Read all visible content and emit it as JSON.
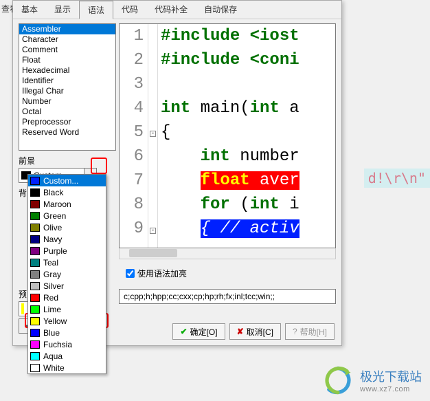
{
  "sidebar_lbl": "查看",
  "bg_snippet": "d!\\r\\n\"",
  "tabs": [
    "基本",
    "显示",
    "语法",
    "代码",
    "代码补全",
    "自动保存"
  ],
  "active_tab": 2,
  "token_list": [
    "Assembler",
    "Character",
    "Comment",
    "Float",
    "Hexadecimal",
    "Identifier",
    "Illegal Char",
    "Number",
    "Octal",
    "Preprocessor",
    "Reserved Word"
  ],
  "token_selected": 0,
  "labels": {
    "fg": "前景",
    "bg": "背",
    "preview": "预"
  },
  "fg_sel": "Custom...",
  "colors": [
    {
      "name": "Custom...",
      "hex": "#0020ff",
      "sel": true
    },
    {
      "name": "Black",
      "hex": "#000000"
    },
    {
      "name": "Maroon",
      "hex": "#800000"
    },
    {
      "name": "Green",
      "hex": "#008000"
    },
    {
      "name": "Olive",
      "hex": "#808000"
    },
    {
      "name": "Navy",
      "hex": "#000080"
    },
    {
      "name": "Purple",
      "hex": "#800080"
    },
    {
      "name": "Teal",
      "hex": "#008080"
    },
    {
      "name": "Gray",
      "hex": "#808080"
    },
    {
      "name": "Silver",
      "hex": "#c0c0c0"
    },
    {
      "name": "Red",
      "hex": "#ff0000"
    },
    {
      "name": "Lime",
      "hex": "#00ff00"
    },
    {
      "name": "Yellow",
      "hex": "#ffff00"
    },
    {
      "name": "Blue",
      "hex": "#0000ff"
    },
    {
      "name": "Fuchsia",
      "hex": "#ff00ff"
    },
    {
      "name": "Aqua",
      "hex": "#00ffff"
    },
    {
      "name": "White",
      "hex": "#ffffff"
    }
  ],
  "checkbox": {
    "label": "使用语法加亮",
    "checked": true
  },
  "ext_input": "c;cpp;h;hpp;cc;cxx;cp;hp;rh;fx;inl;tcc;win;;",
  "buttons": {
    "ok": "确定[O]",
    "cancel": "取消[C]",
    "help": "帮助[H]"
  },
  "editor_lines": [
    {
      "n": "1",
      "seg": [
        {
          "t": "#include ",
          "c": "preproc"
        },
        {
          "t": "<iost",
          "c": "inc-path"
        }
      ]
    },
    {
      "n": "2",
      "seg": [
        {
          "t": "#include ",
          "c": "preproc"
        },
        {
          "t": "<coni",
          "c": "inc-path"
        }
      ]
    },
    {
      "n": "3",
      "seg": []
    },
    {
      "n": "4",
      "seg": [
        {
          "t": "int",
          "c": "kw"
        },
        {
          "t": " main(",
          "c": "txt"
        },
        {
          "t": "int",
          "c": "kw"
        },
        {
          "t": " a",
          "c": "txt"
        }
      ]
    },
    {
      "n": "5",
      "seg": [
        {
          "t": "{",
          "c": "txt"
        }
      ]
    },
    {
      "n": "6",
      "seg": [
        {
          "t": "    ",
          "c": "txt"
        },
        {
          "t": "int",
          "c": "kw"
        },
        {
          "t": " number",
          "c": "txt"
        }
      ]
    },
    {
      "n": "7",
      "seg": [
        {
          "t": "    ",
          "c": "txt"
        },
        {
          "t": "float",
          "c": "kw-hl-red"
        },
        {
          "t": " aver",
          "c": "kw-hl-red",
          "plain": true
        }
      ]
    },
    {
      "n": "8",
      "seg": [
        {
          "t": "    ",
          "c": "txt"
        },
        {
          "t": "for ",
          "c": "kw"
        },
        {
          "t": "(",
          "c": "txt"
        },
        {
          "t": "int",
          "c": "kw"
        },
        {
          "t": " i",
          "c": "txt"
        }
      ]
    },
    {
      "n": "9",
      "seg": [
        {
          "t": "    ",
          "c": "txt"
        },
        {
          "t": "{ ",
          "c": "kw-hl-blue"
        },
        {
          "t": "// activ",
          "c": "kw-hl-blue"
        }
      ]
    }
  ],
  "footer": {
    "cn": "极光下载站",
    "url": "www.xz7.com"
  }
}
